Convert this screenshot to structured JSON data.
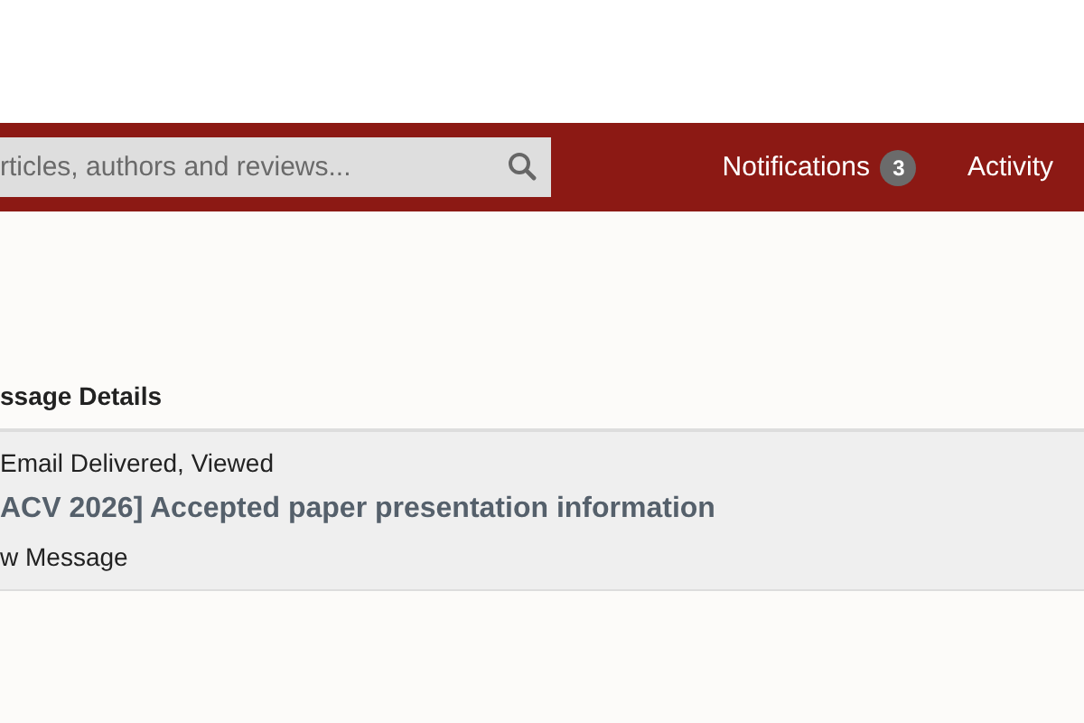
{
  "header": {
    "search": {
      "placeholder": "rticles, authors and reviews..."
    },
    "nav": [
      {
        "label": "Notifications",
        "badge": "3"
      },
      {
        "label": "Activity"
      }
    ]
  },
  "section": {
    "heading": "ssage Details"
  },
  "message": {
    "status": "Email Delivered, Viewed",
    "subject": "ACV 2026] Accepted paper presentation information",
    "link": "w Message"
  }
}
